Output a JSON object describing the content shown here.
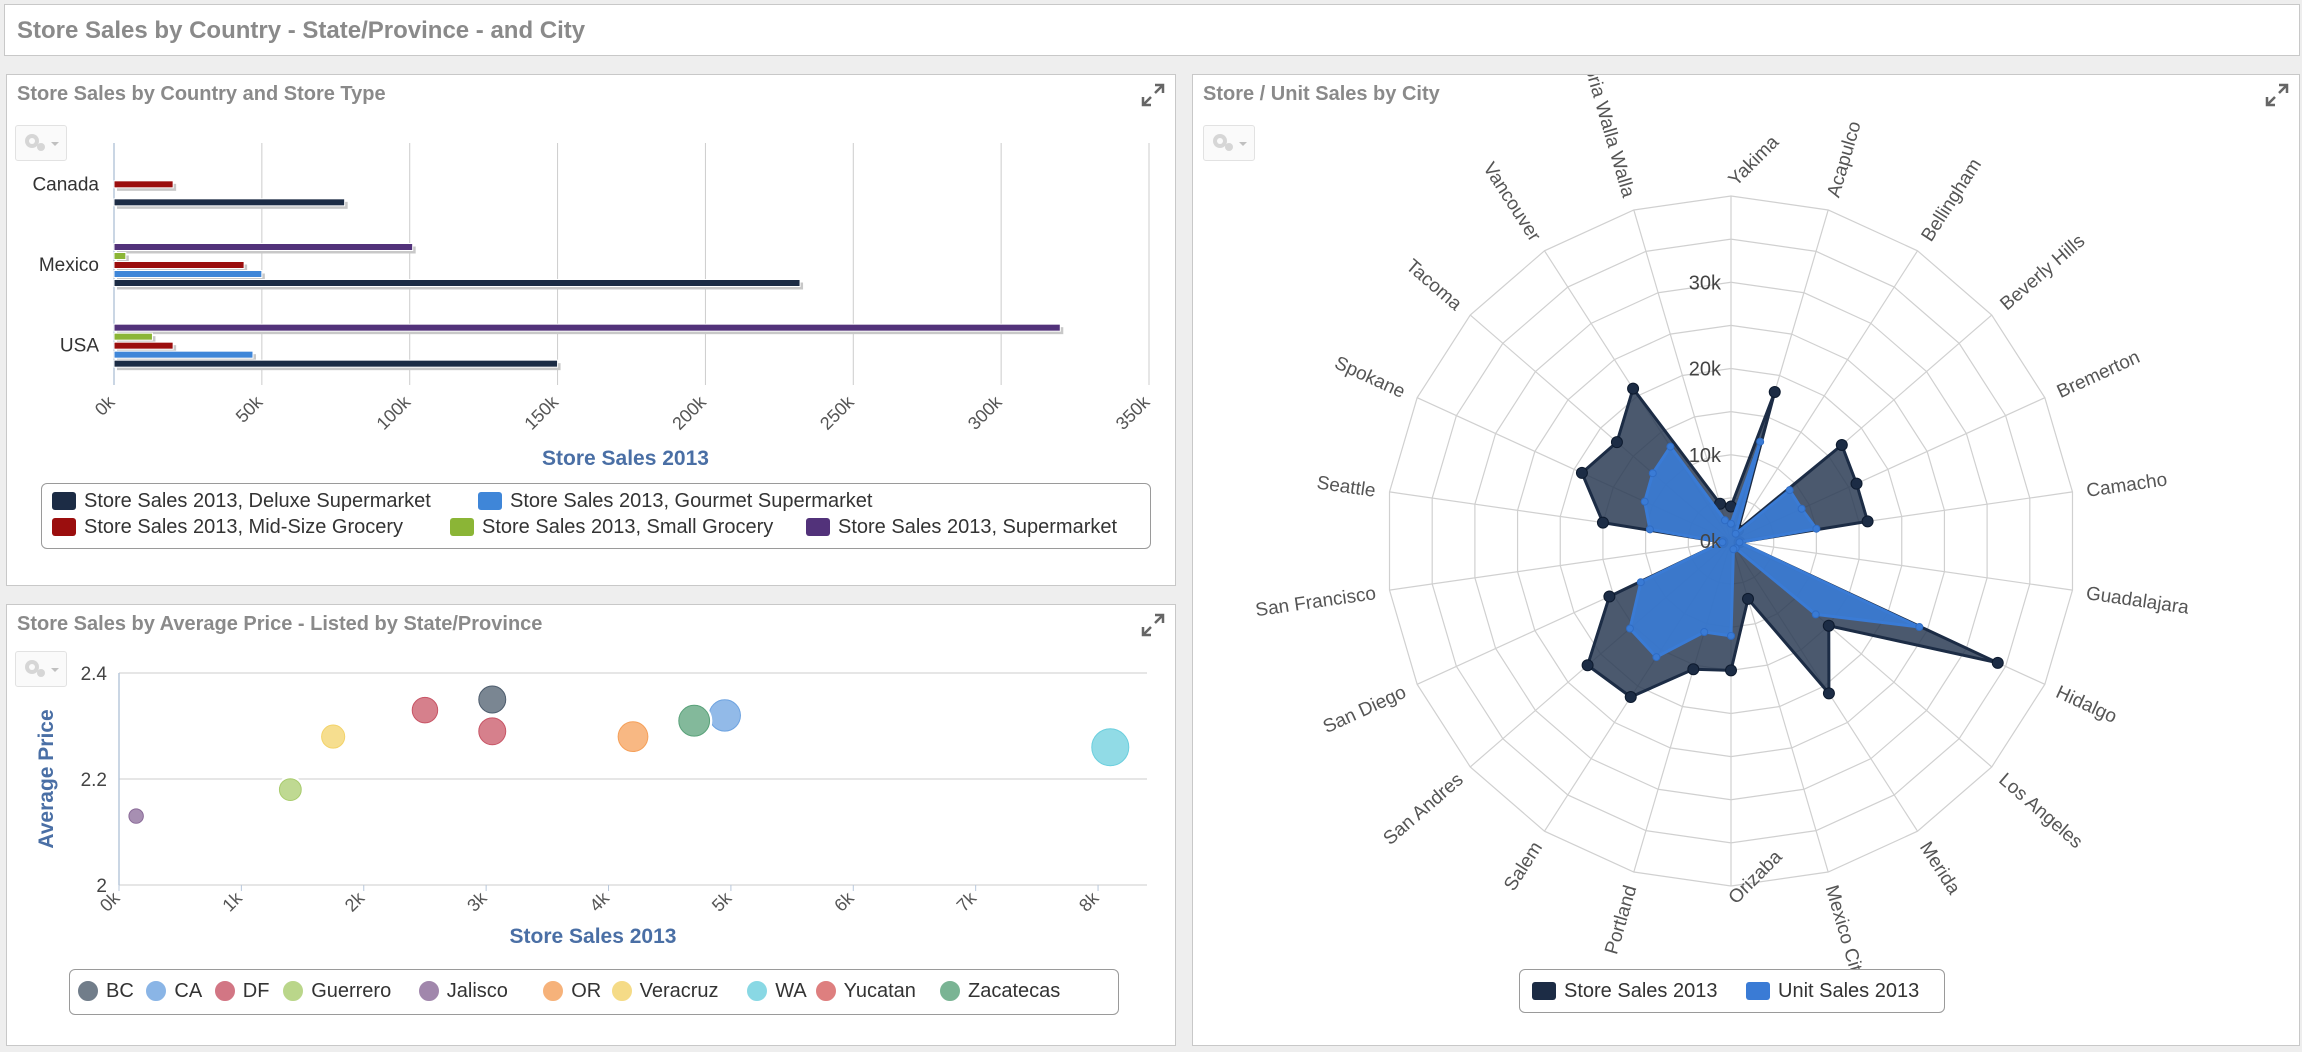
{
  "dashboard": {
    "title": "Store Sales by Country - State/Province - and City"
  },
  "colors": {
    "deluxe": "#1c2c45",
    "gourmet": "#3f86d8",
    "midsize": "#9b0e0e",
    "small": "#8bb536",
    "supermarket": "#52327a",
    "axis_title": "#4a6fa5",
    "grid": "#cccccc",
    "store_sales": "#1c2c45",
    "unit_sales": "#3a7bd5"
  },
  "panels": {
    "bar": {
      "title": "Store Sales by Country and Store Type"
    },
    "bubble": {
      "title": "Store Sales by Average Price - Listed by State/Province"
    },
    "radar": {
      "title": "Store / Unit Sales by City"
    }
  },
  "chart_data": [
    {
      "type": "bar",
      "orientation": "horizontal",
      "categories": [
        "Canada",
        "Mexico",
        "USA"
      ],
      "series": [
        {
          "name": "Store Sales 2013, Deluxe Supermarket",
          "color_key": "deluxe",
          "values": [
            78000,
            232000,
            150000
          ]
        },
        {
          "name": "Store Sales 2013, Gourmet Supermarket",
          "color_key": "gourmet",
          "values": [
            null,
            50000,
            47000
          ]
        },
        {
          "name": "Store Sales 2013, Mid-Size Grocery",
          "color_key": "midsize",
          "values": [
            20000,
            44000,
            20000
          ]
        },
        {
          "name": "Store Sales 2013, Small Grocery",
          "color_key": "small",
          "values": [
            null,
            4000,
            13000
          ]
        },
        {
          "name": "Store Sales 2013, Supermarket",
          "color_key": "supermarket",
          "values": [
            null,
            101000,
            320000
          ]
        }
      ],
      "xlabel": "Store Sales 2013",
      "xlim": [
        0,
        350000
      ],
      "xticks": [
        "0k",
        "50k",
        "100k",
        "150k",
        "200k",
        "250k",
        "300k",
        "350k"
      ],
      "grid": true,
      "legend": "bottom"
    },
    {
      "type": "scatter",
      "bubble": true,
      "xlabel": "Store Sales 2013",
      "ylabel": "Average Price",
      "xlim": [
        0,
        8400
      ],
      "ylim": [
        2,
        2.4
      ],
      "xticks": [
        "0k",
        "1k",
        "2k",
        "3k",
        "4k",
        "5k",
        "6k",
        "7k",
        "8k"
      ],
      "yticks": [
        "2",
        "2.2",
        "2.4"
      ],
      "series": [
        {
          "name": "BC",
          "color": "#4e5d6e",
          "points": [
            {
              "x": 3050,
              "y": 2.35,
              "size": 3050
            }
          ]
        },
        {
          "name": "CA",
          "color": "#6ea3e0",
          "points": [
            {
              "x": 4950,
              "y": 2.32,
              "size": 4950
            }
          ]
        },
        {
          "name": "DF",
          "color": "#c85566",
          "points": [
            {
              "x": 2500,
              "y": 2.33,
              "size": 2500
            },
            {
              "x": 3050,
              "y": 2.29,
              "size": 3050
            }
          ]
        },
        {
          "name": "Guerrero",
          "color": "#a9cc6e",
          "points": [
            {
              "x": 1400,
              "y": 2.18,
              "size": 1400
            }
          ]
        },
        {
          "name": "Jalisco",
          "color": "#8a6a98",
          "points": [
            {
              "x": 140,
              "y": 2.13,
              "size": 140
            }
          ]
        },
        {
          "name": "OR",
          "color": "#f5a05a",
          "points": [
            {
              "x": 4200,
              "y": 2.28,
              "size": 4200
            }
          ]
        },
        {
          "name": "Veracruz",
          "color": "#f3d36a",
          "points": [
            {
              "x": 1750,
              "y": 2.28,
              "size": 1750
            }
          ]
        },
        {
          "name": "WA",
          "color": "#6ccfde",
          "points": [
            {
              "x": 8100,
              "y": 2.26,
              "size": 8100
            }
          ]
        },
        {
          "name": "Yucatan",
          "color": "#d66060",
          "points": []
        },
        {
          "name": "Zacatecas",
          "color": "#5aa27a",
          "points": [
            {
              "x": 4700,
              "y": 2.31,
              "size": 4700
            }
          ]
        }
      ],
      "legend": "bottom"
    },
    {
      "type": "radar",
      "categories": [
        "Acapulco",
        "Bellingham",
        "Beverly Hills",
        "Bremerton",
        "Camacho",
        "Guadalajara",
        "Hidalgo",
        "Los Angeles",
        "Merida",
        "Mexico City",
        "Orizaba",
        "Portland",
        "Salem",
        "San Andres",
        "San Diego",
        "San Francisco",
        "Seattle",
        "Spokane",
        "Tacoma",
        "Vancouver",
        "Victoria Walla Walla",
        "Yakima"
      ],
      "series": [
        {
          "name": "Store Sales 2013",
          "color_key": "store_sales",
          "values": [
            18000,
            1500,
            17000,
            16000,
            16000,
            1000,
            34000,
            15000,
            21000,
            7000,
            15000,
            15500,
            21500,
            22000,
            15500,
            1000,
            15000,
            19000,
            17500,
            21000,
            4500,
            4000
          ]
        },
        {
          "name": "Unit Sales 2013",
          "color_key": "unit_sales",
          "values": [
            12000,
            1000,
            9000,
            9000,
            10000,
            1000,
            24000,
            13000,
            1000,
            1000,
            11000,
            11000,
            16000,
            15500,
            11500,
            1000,
            9500,
            11000,
            12000,
            13000,
            2500,
            2000
          ]
        }
      ],
      "rlim": [
        0,
        40000
      ],
      "rticks": [
        "0k",
        "10k",
        "20k",
        "30k"
      ],
      "legend": "bottom"
    }
  ]
}
